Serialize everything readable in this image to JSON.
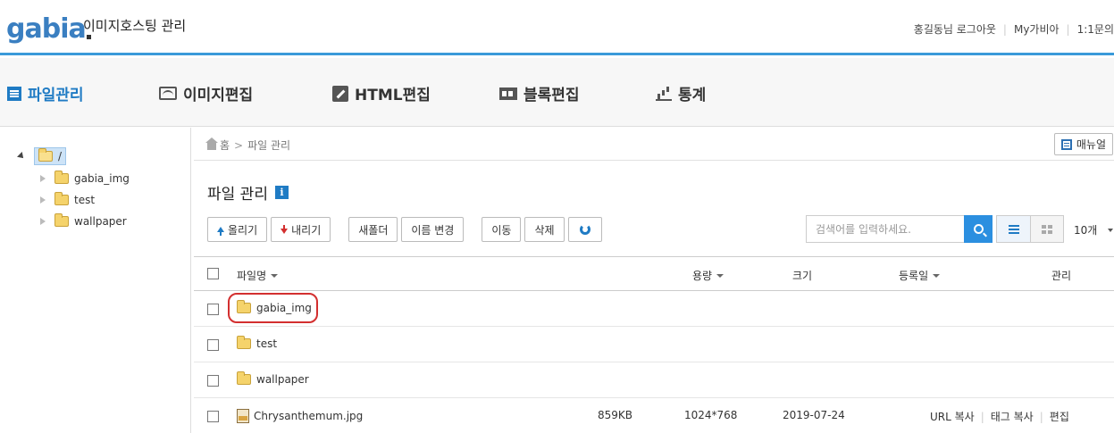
{
  "header": {
    "logo_text": "gabia",
    "app_title": "이미지호스팅 관리",
    "links": [
      "홍길동님 로그아웃",
      "My가비아",
      "1:1문의"
    ],
    "accent_color": "#3a9ad9"
  },
  "nav": {
    "items": [
      {
        "label": "파일관리",
        "icon": "file-list-icon",
        "active": true
      },
      {
        "label": "이미지편집",
        "icon": "image-icon",
        "active": false
      },
      {
        "label": "HTML편집",
        "icon": "pen-icon",
        "active": false
      },
      {
        "label": "블록편집",
        "icon": "block-icon",
        "active": false
      },
      {
        "label": "통계",
        "icon": "bar-chart-icon",
        "active": false
      }
    ]
  },
  "tree": {
    "root_label": "/",
    "children": [
      "gabia_img",
      "test",
      "wallpaper"
    ]
  },
  "breadcrumb": {
    "home": "홈",
    "separator": ">",
    "current": "파일 관리"
  },
  "manual_button": "매뉴얼",
  "page_title": "파일 관리",
  "info_badge": "i",
  "toolbar": {
    "upload": "올리기",
    "download": "내리기",
    "new_folder": "새폴더",
    "rename": "이름 변경",
    "move": "이동",
    "delete": "삭제"
  },
  "search": {
    "placeholder": "검색어를 입력하세요."
  },
  "per_page": "10개",
  "table": {
    "columns": {
      "name": "파일명",
      "size": "용량",
      "dimensions": "크기",
      "date": "등록일",
      "manage": "관리"
    },
    "rows": [
      {
        "type": "folder",
        "name": "gabia_img",
        "size": "",
        "dimensions": "",
        "date": "",
        "highlighted": true
      },
      {
        "type": "folder",
        "name": "test",
        "size": "",
        "dimensions": "",
        "date": ""
      },
      {
        "type": "folder",
        "name": "wallpaper",
        "size": "",
        "dimensions": "",
        "date": ""
      },
      {
        "type": "file",
        "name": "Chrysanthemum.jpg",
        "size": "859KB",
        "dimensions": "1024*768",
        "date": "2019-07-24",
        "actions": [
          "URL 복사",
          "태그 복사",
          "편집"
        ]
      }
    ]
  },
  "highlight_color": "#d32f2f"
}
